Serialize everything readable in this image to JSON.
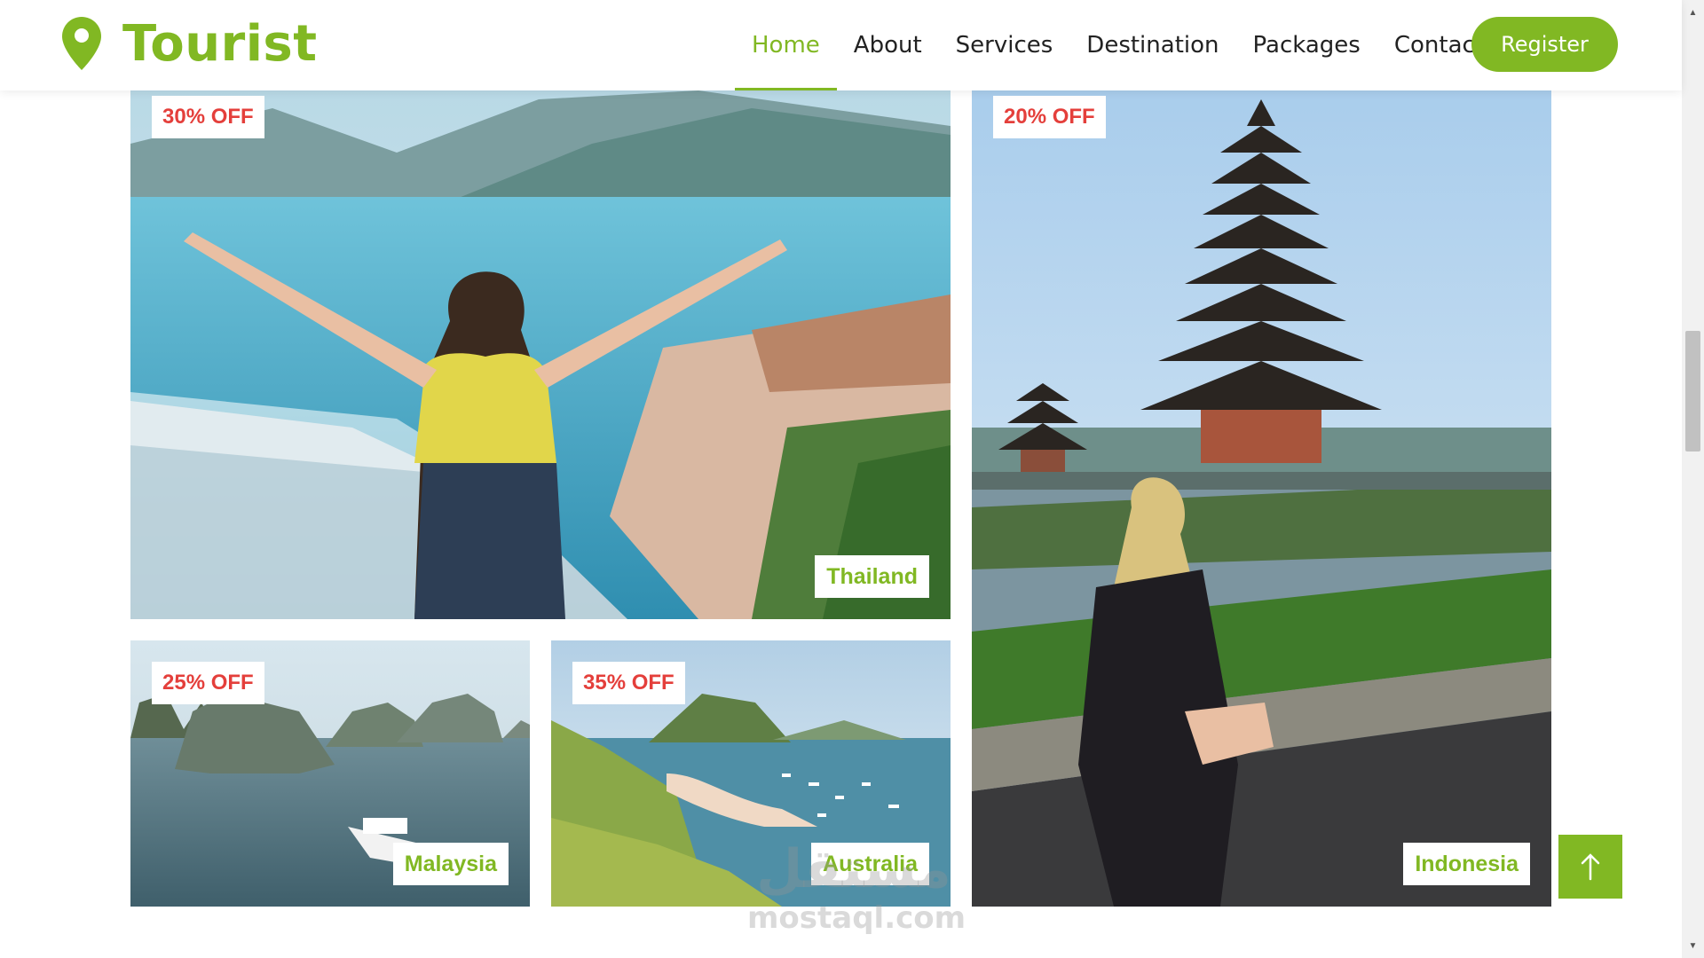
{
  "brand": {
    "name": "Tourist",
    "icon": "map-pin-icon",
    "color": "#81b823"
  },
  "nav": {
    "items": [
      {
        "label": "Home",
        "active": true
      },
      {
        "label": "About",
        "active": false
      },
      {
        "label": "Services",
        "active": false
      },
      {
        "label": "Destination",
        "active": false
      },
      {
        "label": "Packages",
        "active": false
      },
      {
        "label": "Contact",
        "active": false
      }
    ],
    "register_label": "Register"
  },
  "destinations": {
    "thailand": {
      "discount": "30% OFF",
      "location": "Thailand"
    },
    "indonesia": {
      "discount": "20% OFF",
      "location": "Indonesia"
    },
    "malaysia": {
      "discount": "25% OFF",
      "location": "Malaysia"
    },
    "australia": {
      "discount": "35% OFF",
      "location": "Australia"
    }
  },
  "back_to_top": {
    "icon": "arrow-up-icon"
  },
  "watermark": {
    "arabic": "مستقل",
    "latin": "mostaql.com"
  },
  "colors": {
    "accent": "#81b823",
    "discount_text": "#e43f3b"
  }
}
